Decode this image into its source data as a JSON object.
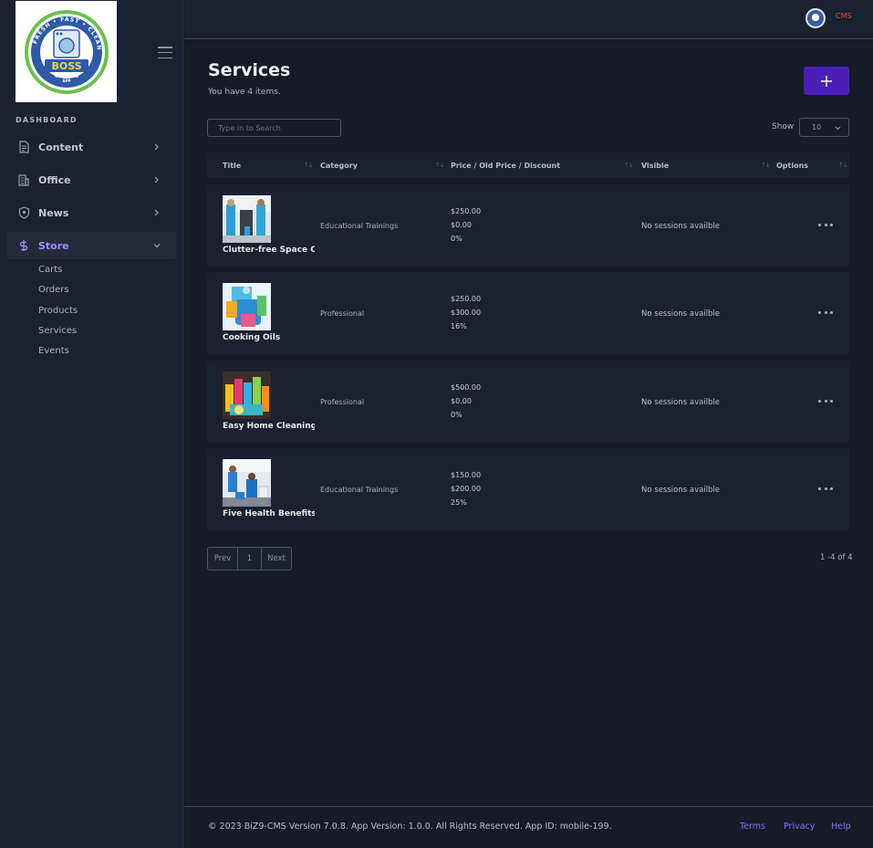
{
  "sidebar": {
    "logo": {
      "ring_text": "FRESH • FAST • CLEAN",
      "brand": "BOSS",
      "tagline": "CLEANING",
      "tagline2": "APP",
      "estd": "ESTD",
      "year": "2022"
    },
    "section_label": "DASHBOARD",
    "items": [
      {
        "label": "Content",
        "icon": "document-icon"
      },
      {
        "label": "Office",
        "icon": "building-icon"
      },
      {
        "label": "News",
        "icon": "shield-icon"
      },
      {
        "label": "Store",
        "icon": "dollar-icon"
      }
    ],
    "store_subitems": [
      "Carts",
      "Orders",
      "Products",
      "Services",
      "Events"
    ]
  },
  "header": {
    "cms_label": "CMS"
  },
  "main": {
    "title": "Services",
    "subtitle": "You have 4 items.",
    "add_button_label": "+",
    "search_placeholder": "Type in to Search",
    "show_label": "Show",
    "show_value": "10",
    "columns": [
      "Title",
      "Category",
      "Price / Old Price / Discount",
      "Visible",
      "Options"
    ],
    "rows": [
      {
        "title": "Clutter-free Space Cleaning",
        "category": "Educational Trainings",
        "price": "$250.00",
        "old_price": "$0.00",
        "discount": "0%",
        "visible": "No sessions availble"
      },
      {
        "title": "Cooking Oils",
        "category": "Professional",
        "price": "$250.00",
        "old_price": "$300.00",
        "discount": "16%",
        "visible": "No sessions availble"
      },
      {
        "title": "Easy Home Cleaning Products",
        "category": "Professional",
        "price": "$500.00",
        "old_price": "$0.00",
        "discount": "0%",
        "visible": "No sessions availble"
      },
      {
        "title": "Five Health Benefits of Cleaning",
        "category": "Educational Trainings",
        "price": "$150.00",
        "old_price": "$200.00",
        "discount": "25%",
        "visible": "No sessions availble"
      }
    ],
    "pagination": {
      "prev": "Prev",
      "page": "1",
      "next": "Next",
      "count": "1 -4 of 4"
    }
  },
  "footer": {
    "copyright": "© 2023 BiZ9-CMS Version 7.0.8. App Version: 1.0.0. All Rights Reserved. App ID: mobile-199.",
    "links": [
      "Terms",
      "Privacy",
      "Help"
    ]
  },
  "colors": {
    "background": "#151b27",
    "panel": "#1a2130",
    "accent": "#4c1fb8",
    "link": "#8b6cf6",
    "active_nav": "#a78bfa",
    "cms_red": "#e0502a"
  }
}
